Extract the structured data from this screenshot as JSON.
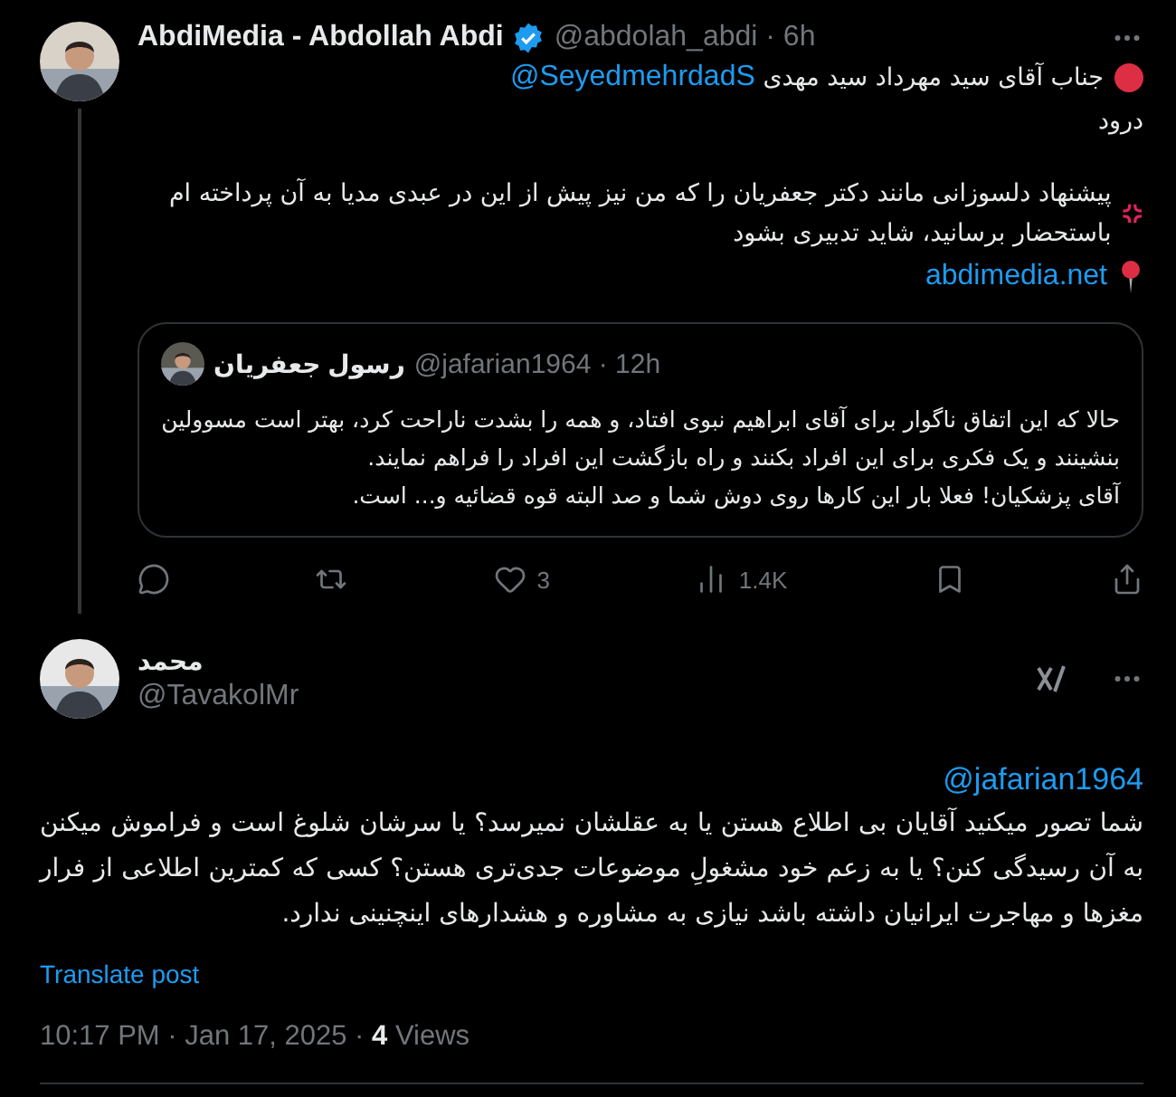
{
  "post": {
    "author": {
      "name": "AbdiMedia - Abdollah Abdi",
      "verified": true,
      "meta": "@abdolah_abdi · 6h"
    },
    "paragraphs": [
      {
        "kind": "alert",
        "text": "جناب آقای سید مهرداد سید مهدی",
        "mention": "@SeyedmehrdadS"
      },
      {
        "kind": "plain",
        "text": "درود"
      },
      {
        "kind": "anger",
        "text": "پیشنهاد دلسوزانی مانند دکتر جعفریان را که من نیز پیش از این در عبدی مدیا به آن پرداخته ام باستحضار برسانید، شاید تدبیری بشود"
      },
      {
        "kind": "location",
        "link": "abdimedia.net"
      }
    ],
    "quote": {
      "name": "رسول جعفریان",
      "meta": "@jafarian1964 · 12h",
      "paragraphs": [
        "حالا که این اتفاق ناگوار برای آقای ابراهیم نبوی افتاد، و همه را بشدت ناراحت کرد، بهتر است مسوولین بنشینند و یک فکری برای این افراد بکنند و راه بازگشت این افراد را فراهم نمایند.",
        "آقای پزشکیان! فعلا بار این کارها روی دوش شما و صد البته قوه قضائیه و... است."
      ]
    },
    "like_count": "3",
    "view_count": "1.4K"
  },
  "reply": {
    "author": {
      "name": "محمد",
      "handle": "@TavakolMr"
    },
    "mention": "@jafarian1964",
    "text": "شما تصور میکنید آقایان بی اطلاع هستن یا به عقلشان نمیرسد؟ یا سرشان شلوغ است و فراموش میکنن به آن رسیدگی کنن؟ یا به زعم خود مشغولِ موضوعات جدی‌تری هستن؟ کسی که کمترین اطلاعی از فرار مغزها و مهاجرت ایرانیان داشته باشد نیازی به مشاوره و هشدارهای اینچنینی ندارد.",
    "translate": "Translate post",
    "timestamp": "10:17 PM · Jan 17, 2025 · **4** Views"
  }
}
